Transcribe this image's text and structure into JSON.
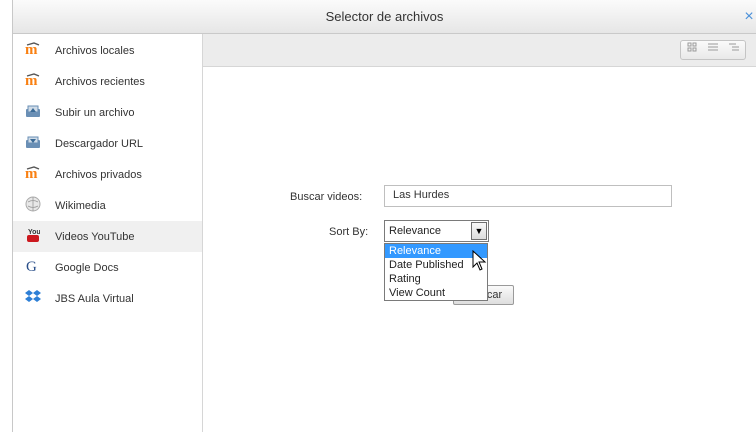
{
  "dialog": {
    "title": "Selector de archivos",
    "close_glyph": "×"
  },
  "sidebar": {
    "items": [
      {
        "label": "Archivos locales",
        "icon": "moodle-icon",
        "active": false
      },
      {
        "label": "Archivos recientes",
        "icon": "moodle-icon",
        "active": false
      },
      {
        "label": "Subir un archivo",
        "icon": "upload-icon",
        "active": false
      },
      {
        "label": "Descargador URL",
        "icon": "url-downloader-icon",
        "active": false
      },
      {
        "label": "Archivos privados",
        "icon": "moodle-icon",
        "active": false
      },
      {
        "label": "Wikimedia",
        "icon": "wikimedia-icon",
        "active": false
      },
      {
        "label": "Videos YouTube",
        "icon": "youtube-icon",
        "active": true
      },
      {
        "label": "Google Docs",
        "icon": "google-icon",
        "active": false
      },
      {
        "label": "JBS Aula Virtual",
        "icon": "dropbox-icon",
        "active": false
      }
    ]
  },
  "toolbar": {
    "view_icons": [
      "grid-view-icon",
      "list-view-icon",
      "tree-view-icon"
    ]
  },
  "form": {
    "search_label": "Buscar videos:",
    "search_value": "Las Hurdes",
    "sort_label": "Sort By:",
    "sort_selected": "Relevance",
    "sort_options": [
      "Relevance",
      "Date Published",
      "Rating",
      "View Count"
    ],
    "search_button_visible": "car"
  },
  "colors": {
    "accent": "#3399ff",
    "close": "#4a90d9",
    "moodle_orange": "#f98012"
  }
}
